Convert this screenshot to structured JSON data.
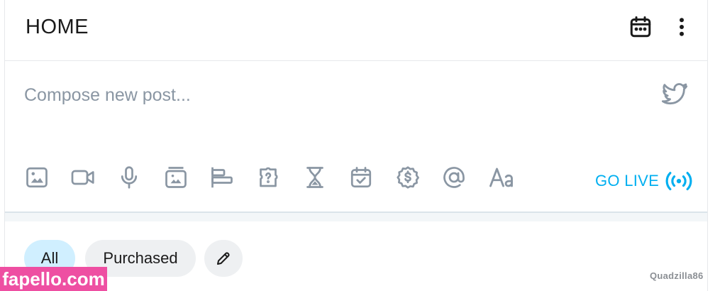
{
  "header": {
    "title": "HOME",
    "icons": [
      "calendar-icon",
      "more-vertical-icon"
    ]
  },
  "compose": {
    "placeholder": "Compose new post...",
    "share_icon": "twitter-icon",
    "toolbar": [
      "image-icon",
      "video-icon",
      "microphone-icon",
      "vault-icon",
      "poll-icon",
      "quiz-icon",
      "hourglass-icon",
      "schedule-icon",
      "price-tag-icon",
      "mention-icon",
      "text-format-icon"
    ],
    "go_live_label": "GO LIVE"
  },
  "filters": {
    "items": [
      {
        "label": "All",
        "selected": true
      },
      {
        "label": "Purchased",
        "selected": false
      }
    ],
    "edit_icon": "pencil-icon"
  },
  "watermark": {
    "site": "fapello.com",
    "user": "Quadzilla86"
  },
  "colors": {
    "accent": "#00aff0",
    "icon_gray": "#8a96a3",
    "chip_selected": "#d0efff",
    "chip_default": "#eef0f2",
    "watermark": "#ee4fa2"
  }
}
